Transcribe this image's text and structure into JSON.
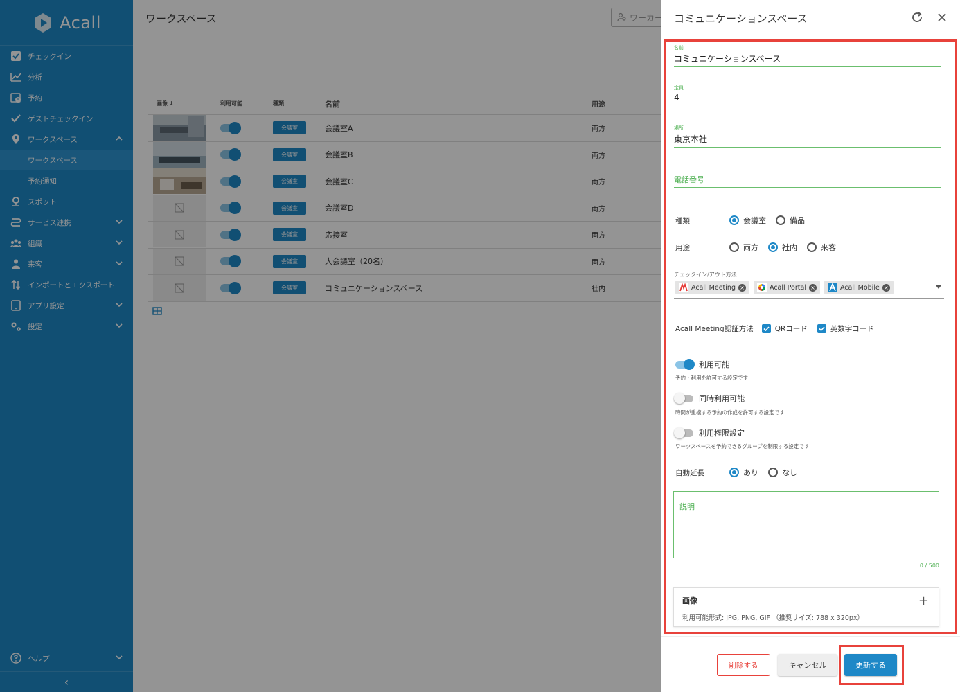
{
  "app": {
    "logo_text": "Acall"
  },
  "sidebar": {
    "items": [
      {
        "label": "チェックイン"
      },
      {
        "label": "分析"
      },
      {
        "label": "予約"
      },
      {
        "label": "ゲストチェックイン"
      },
      {
        "label": "ワークスペース"
      },
      {
        "label": "ワークスペース"
      },
      {
        "label": "予約通知"
      },
      {
        "label": "スポット"
      },
      {
        "label": "サービス連携"
      },
      {
        "label": "組織"
      },
      {
        "label": "来客"
      },
      {
        "label": "インポートとエクスポート"
      },
      {
        "label": "アプリ設定"
      },
      {
        "label": "設定"
      }
    ],
    "help": "ヘルプ",
    "collapse": "‹"
  },
  "main": {
    "title": "ワークスペース",
    "search_placeholder": "ワーカー",
    "columns": {
      "image": "画像",
      "available": "利用可能",
      "type": "種類",
      "name": "名前",
      "use": "用途"
    },
    "rows": [
      {
        "type": "会議室",
        "name": "会議室A",
        "use": "両方"
      },
      {
        "type": "会議室",
        "name": "会議室B",
        "use": "両方"
      },
      {
        "type": "会議室",
        "name": "会議室C",
        "use": "両方"
      },
      {
        "type": "会議室",
        "name": "会議室D",
        "use": "両方"
      },
      {
        "type": "会議室",
        "name": "応接室",
        "use": "両方"
      },
      {
        "type": "会議室",
        "name": "大会議室（20名）",
        "use": "両方"
      },
      {
        "type": "会議室",
        "name": "コミュニケーションスペース",
        "use": "社内"
      }
    ]
  },
  "drawer": {
    "title": "コミュニケーションスペース",
    "fields": {
      "name": {
        "label": "名前",
        "value": "コミュニケーションスペース"
      },
      "capacity": {
        "label": "定員",
        "value": "4"
      },
      "location": {
        "label": "場所",
        "value": "東京本社"
      },
      "phone": {
        "placeholder": "電話番号"
      }
    },
    "kind": {
      "label": "種類",
      "options": [
        "会議室",
        "備品"
      ],
      "selected": "会議室"
    },
    "purpose": {
      "label": "用途",
      "options": [
        "両方",
        "社内",
        "来客"
      ],
      "selected": "社内"
    },
    "checkin": {
      "label": "チェックイン/アウト方法",
      "chips": [
        "Acall Meeting",
        "Acall Portal",
        "Acall Mobile"
      ]
    },
    "auth": {
      "label": "Acall Meeting認証方法",
      "options": [
        "QRコード",
        "英数字コード"
      ]
    },
    "switches": [
      {
        "label": "利用可能",
        "hint": "予約・利用を許可する設定です",
        "on": true
      },
      {
        "label": "同時利用可能",
        "hint": "時間が重複する予約の作成を許可する設定です",
        "on": false
      },
      {
        "label": "利用権限設定",
        "hint": "ワークスペースを予約できるグループを制限する設定です",
        "on": false
      }
    ],
    "auto_extend": {
      "label": "自動延長",
      "options": [
        "あり",
        "なし"
      ],
      "selected": "あり"
    },
    "description": {
      "placeholder": "説明",
      "counter": "0 / 500"
    },
    "image": {
      "title": "画像",
      "hint": "利用可能形式: JPG, PNG, GIF （推奨サイズ: 788 x 320px）"
    },
    "buttons": {
      "delete": "削除する",
      "cancel": "キャンセル",
      "update": "更新する"
    }
  },
  "colors": {
    "primary": "#1e88c7",
    "highlight": "#e8423b",
    "field_green": "#4caf50"
  }
}
